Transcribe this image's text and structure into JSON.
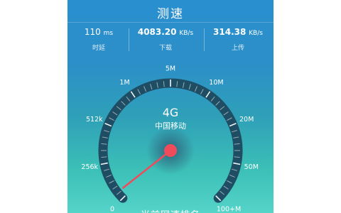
{
  "app": {
    "title": "测速"
  },
  "stats": {
    "latency": {
      "value": "110",
      "unit": "ms",
      "label": "时延"
    },
    "download": {
      "value": "4083.20",
      "unit": "KB/s",
      "label": "下载"
    },
    "upload": {
      "value": "314.38",
      "unit": "KB/s",
      "label": "上传"
    }
  },
  "gauge": {
    "network": "4G",
    "carrier": "中国移动",
    "tick_labels": [
      "0",
      "256k",
      "512k",
      "1M",
      "5M",
      "10M",
      "20M",
      "50M",
      "100+M"
    ],
    "needle_tick_position": 0.2
  },
  "footer": {
    "text": "当前网速排名"
  },
  "colors": {
    "accent": "#f04b5b",
    "arc": "#1f4d63"
  }
}
